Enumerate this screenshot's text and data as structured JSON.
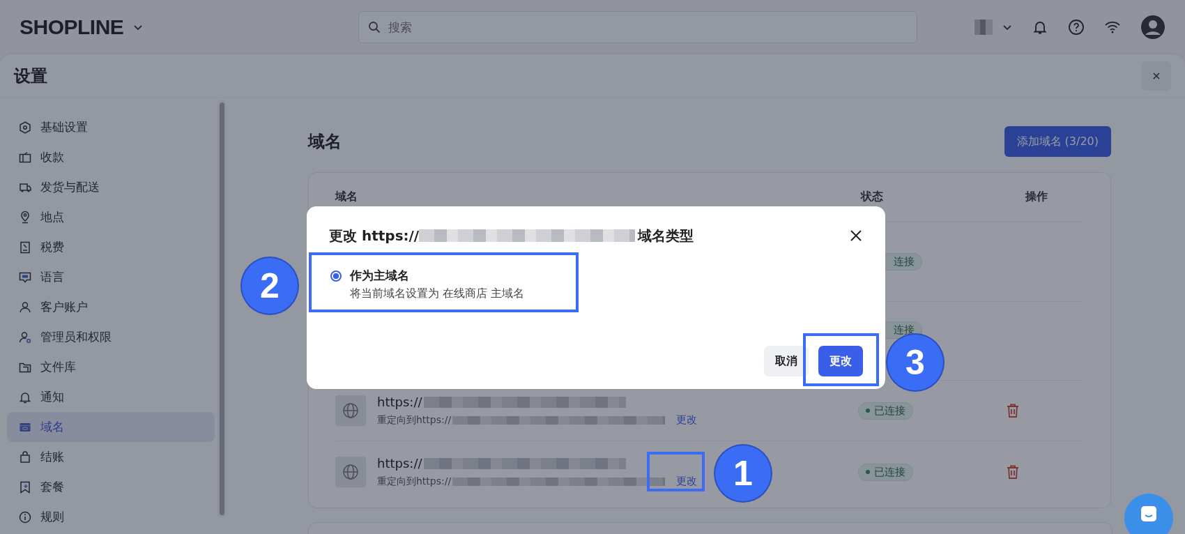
{
  "header": {
    "logo": "SHOPLINE",
    "search": {
      "placeholder": "搜索"
    }
  },
  "settings": {
    "title": "设置",
    "sidebar": {
      "items": [
        {
          "label": "基础设置",
          "selected": false
        },
        {
          "label": "收款",
          "selected": false
        },
        {
          "label": "发货与配送",
          "selected": false
        },
        {
          "label": "地点",
          "selected": false
        },
        {
          "label": "税费",
          "selected": false
        },
        {
          "label": "语言",
          "selected": false
        },
        {
          "label": "客户账户",
          "selected": false
        },
        {
          "label": "管理员和权限",
          "selected": false
        },
        {
          "label": "文件库",
          "selected": false
        },
        {
          "label": "通知",
          "selected": false
        },
        {
          "label": "域名",
          "selected": true
        },
        {
          "label": "结账",
          "selected": false
        },
        {
          "label": "套餐",
          "selected": false
        },
        {
          "label": "规则",
          "selected": false
        }
      ]
    }
  },
  "domains": {
    "title": "域名",
    "add_button": "添加域名 (3/20)",
    "columns": [
      "域名",
      "状态",
      "操作"
    ],
    "rows": [
      {
        "kind": "covered",
        "status": "连接"
      },
      {
        "kind": "covered",
        "status": "连接"
      },
      {
        "kind": "full",
        "url_prefix": "https://",
        "redirect_prefix": "重定向到https://",
        "change_link": "更改",
        "status": "已连接"
      },
      {
        "kind": "full",
        "url_prefix": "https://",
        "redirect_prefix": "重定向到https://",
        "change_link": "更改",
        "status": "已连接"
      }
    ]
  },
  "dialog": {
    "title_prefix": "更改 https://",
    "title_suffix": "域名类型",
    "options": [
      {
        "label": "作为主域名",
        "description": "将当前域名设置为 在线商店 主域名",
        "selected": true
      }
    ],
    "buttons": [
      {
        "label": "取消",
        "kind": "secondary"
      },
      {
        "label": "更改",
        "kind": "primary"
      }
    ]
  },
  "annotations": [
    {
      "number": "2"
    },
    {
      "number": "1"
    },
    {
      "number": "3"
    }
  ]
}
